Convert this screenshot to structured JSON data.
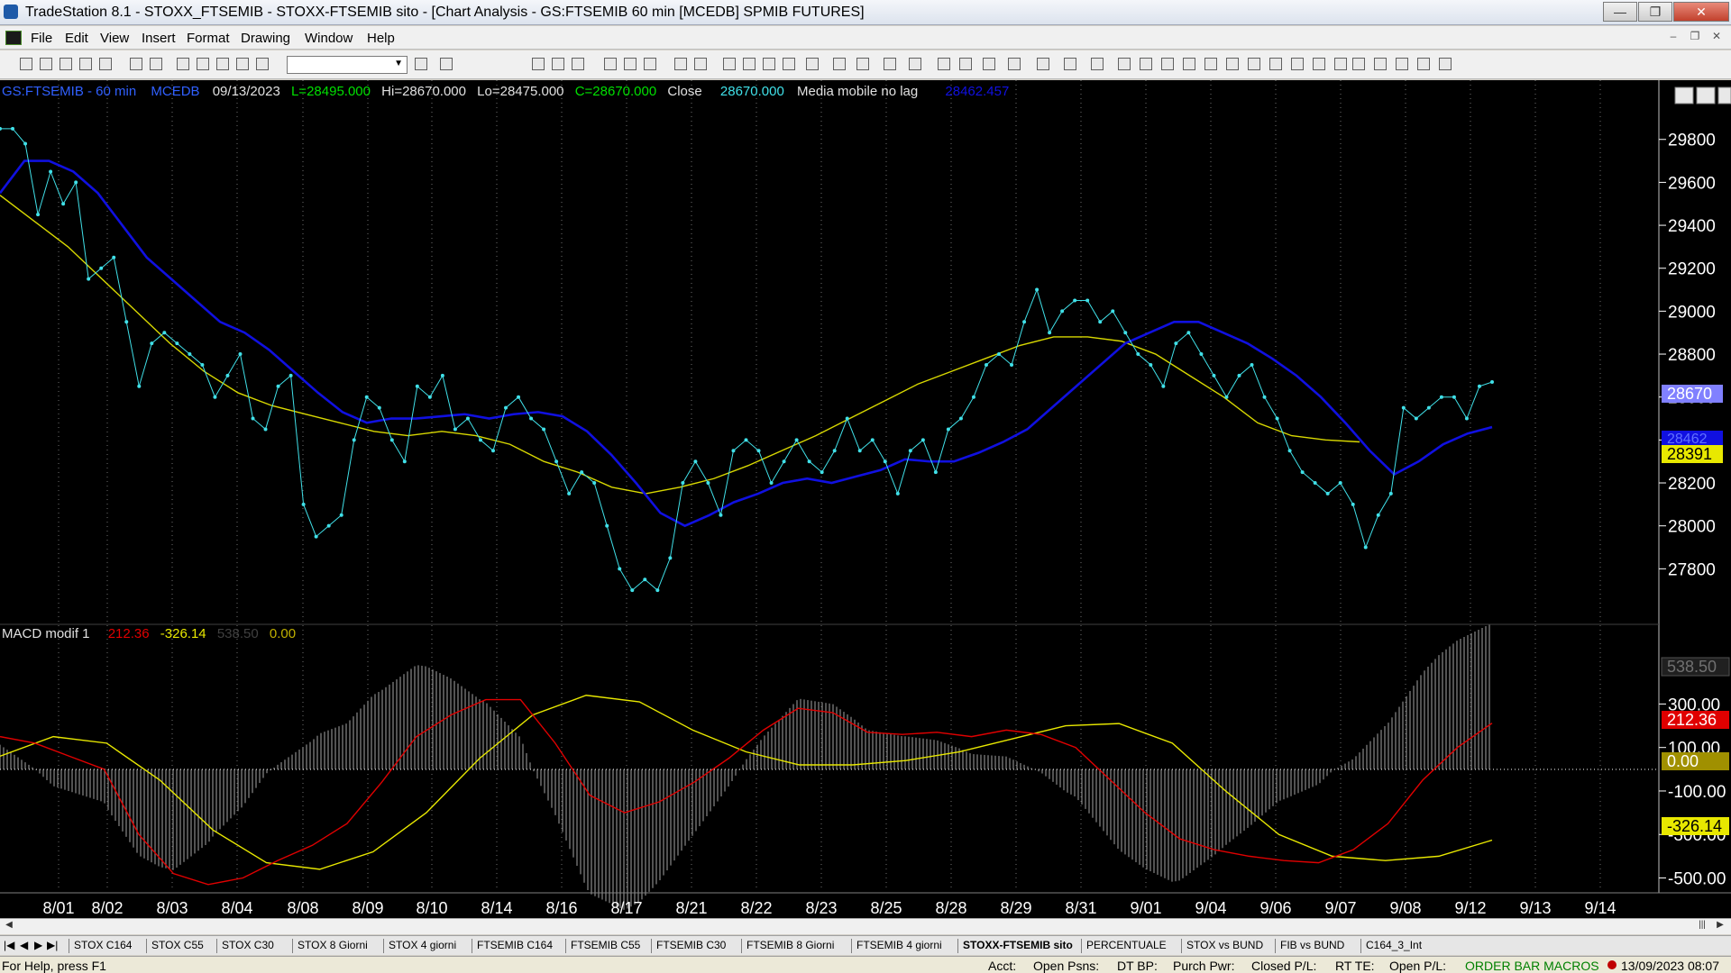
{
  "window": {
    "title": "TradeStation 8.1 - STOXX_FTSEMIB - STOXX-FTSEMIB sito - [Chart Analysis - GS:FTSEMIB  60 min  [MCEDB] SPMIB FUTURES]"
  },
  "menu": [
    "File",
    "Edit",
    "View",
    "Insert",
    "Format",
    "Drawing",
    "Window",
    "Help"
  ],
  "price_header": {
    "symbol": "GS:FTSEMIB - 60 min",
    "source": "MCEDB",
    "date": "09/13/2023",
    "low_open": "L=28495.000",
    "hi": "Hi=28670.000",
    "lo": "Lo=28475.000",
    "close": "C=28670.000",
    "close_label": "Close",
    "close_value": "28670.000",
    "ma_label": "Media mobile no lag",
    "ma_value": "28462.457"
  },
  "macd_header": {
    "label": "MACD modif 1",
    "macd": "212.36",
    "signal": "-326.14",
    "hist": "538.50",
    "zero": "0.00"
  },
  "price_axis": {
    "ticks": [
      "29800",
      "29600",
      "29400",
      "29200",
      "29000",
      "28800",
      "28600",
      "28400",
      "28200",
      "28000",
      "27800"
    ],
    "markers": {
      "last": "28670",
      "ma": "28462",
      "yellow": "28391"
    }
  },
  "macd_axis": {
    "ticks": [
      "300.00",
      "100.00",
      "-100.00",
      "-300.00",
      "-500.00"
    ],
    "markers": {
      "hist": "538.50",
      "macd": "212.36",
      "zero": "0.00",
      "signal": "-326.14"
    }
  },
  "x_axis": [
    "8/01",
    "8/02",
    "8/03",
    "8/04",
    "8/08",
    "8/09",
    "8/10",
    "8/14",
    "8/16",
    "8/17",
    "8/21",
    "8/22",
    "8/23",
    "8/25",
    "8/28",
    "8/29",
    "8/31",
    "9/01",
    "9/04",
    "9/06",
    "9/07",
    "9/08",
    "9/12",
    "9/13",
    "9/14"
  ],
  "tabs": [
    "STOX C164",
    "STOX C55",
    "STOX  C30",
    "STOX  8 Giorni",
    "STOX 4 giorni",
    "FTSEMIB C164",
    "FTSEMIB C55",
    "FTSEMIB C30",
    "FTSEMIB  8 Giorni",
    "FTSEMIB  4 giorni",
    "STOXX-FTSEMIB sito",
    "PERCENTUALE",
    "STOX vs BUND",
    "FIB vs BUND",
    "C164_3_Int"
  ],
  "status": {
    "help": "For Help, press F1",
    "acct": "Acct:",
    "open_psns": "Open Psns:",
    "dt_bp": "DT BP:",
    "purch_pwr": "Purch Pwr:",
    "closed_pl": "Closed P/L:",
    "rt_te": "RT TE:",
    "open_pl": "Open P/L:",
    "macros": "ORDER BAR  MACROS",
    "datetime": "13/09/2023 08:07"
  },
  "colors": {
    "price": "#40e0e8",
    "ma_blue": "#1010e0",
    "ma_yellow": "#d8d800",
    "macd_red": "#e00000",
    "signal_yellow": "#e8e800",
    "hist": "#909090"
  },
  "chart_data": {
    "type": "line",
    "price_series": [
      29850,
      29850,
      29780,
      29450,
      29650,
      29500,
      29600,
      29150,
      29200,
      29250,
      28950,
      28650,
      28850,
      28900,
      28850,
      28800,
      28750,
      28600,
      28700,
      28800,
      28500,
      28450,
      28650,
      28700,
      28100,
      27950,
      28000,
      28050,
      28400,
      28600,
      28550,
      28400,
      28300,
      28650,
      28600,
      28700,
      28450,
      28500,
      28400,
      28350,
      28550,
      28600,
      28500,
      28450,
      28300,
      28150,
      28250,
      28200,
      28000,
      27800,
      27700,
      27750,
      27700,
      27850,
      28200,
      28300,
      28200,
      28050,
      28350,
      28400,
      28350,
      28200,
      28300,
      28400,
      28300,
      28250,
      28350,
      28500,
      28350,
      28400,
      28300,
      28150,
      28350,
      28400,
      28250,
      28450,
      28500,
      28600,
      28750,
      28800,
      28750,
      28950,
      29100,
      28900,
      29000,
      29050,
      29050,
      28950,
      29000,
      28900,
      28800,
      28750,
      28650,
      28850,
      28900,
      28800,
      28700,
      28600,
      28700,
      28750,
      28600,
      28500,
      28350,
      28250,
      28200,
      28150,
      28200,
      28100,
      27900,
      28050,
      28150,
      28550,
      28500,
      28550,
      28600,
      28600,
      28500,
      28650,
      28670
    ],
    "ma_blue": [
      29550,
      29700,
      29700,
      29650,
      29550,
      29400,
      29250,
      29150,
      29050,
      28950,
      28900,
      28820,
      28720,
      28620,
      28530,
      28480,
      28500,
      28500,
      28510,
      28520,
      28500,
      28520,
      28530,
      28510,
      28440,
      28330,
      28200,
      28060,
      28000,
      28050,
      28110,
      28150,
      28200,
      28220,
      28200,
      28230,
      28260,
      28310,
      28300,
      28300,
      28340,
      28390,
      28450,
      28550,
      28650,
      28750,
      28850,
      28900,
      28950,
      28950,
      28900,
      28850,
      28780,
      28700,
      28600,
      28480,
      28350,
      28240,
      28300,
      28380,
      28430,
      28460
    ],
    "ma_yellow": [
      29540,
      29420,
      29300,
      29150,
      29000,
      28850,
      28720,
      28620,
      28560,
      28520,
      28480,
      28440,
      28420,
      28440,
      28420,
      28380,
      28300,
      28250,
      28180,
      28150,
      28180,
      28220,
      28280,
      28350,
      28420,
      28500,
      28580,
      28660,
      28720,
      28780,
      28840,
      28880,
      28880,
      28860,
      28800,
      28700,
      28600,
      28480,
      28420,
      28400,
      28391
    ],
    "macd": [
      150,
      120,
      60,
      0,
      -300,
      -480,
      -530,
      -500,
      -420,
      -350,
      -250,
      -60,
      150,
      250,
      320,
      320,
      120,
      -120,
      -200,
      -150,
      -60,
      50,
      180,
      280,
      260,
      170,
      160,
      170,
      150,
      180,
      160,
      100,
      -50,
      -200,
      -320,
      -370,
      -400,
      -420,
      -430,
      -370,
      -250,
      -50,
      100,
      212
    ],
    "signal": [
      60,
      150,
      120,
      -50,
      -280,
      -430,
      -460,
      -380,
      -200,
      50,
      250,
      340,
      310,
      180,
      80,
      20,
      20,
      40,
      80,
      140,
      200,
      210,
      120,
      -100,
      -300,
      -400,
      -420,
      -400,
      -326
    ],
    "hist_range": [
      -500,
      540
    ],
    "price_range": [
      27600,
      29950
    ],
    "macd_range": [
      -560,
      600
    ]
  }
}
